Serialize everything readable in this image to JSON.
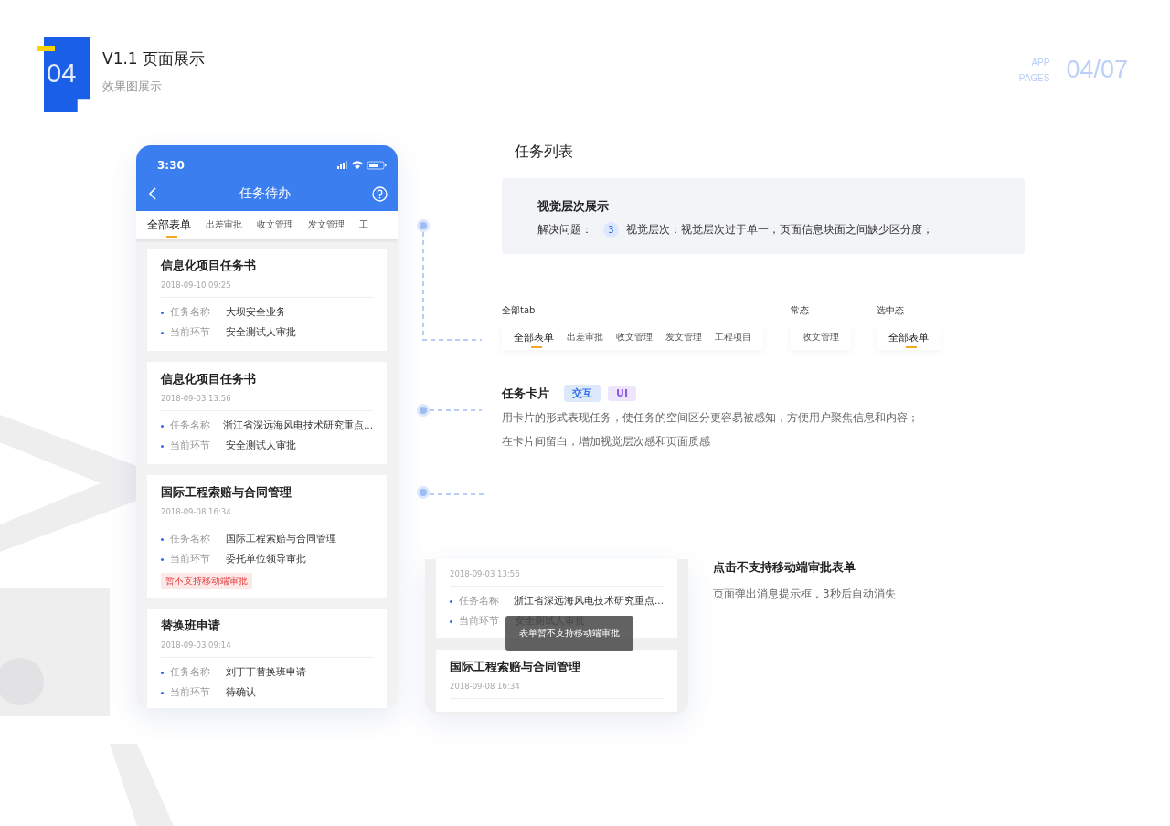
{
  "header": {
    "badge_number": "04",
    "title": "V1.1 页面展示",
    "subtitle": "效果图展示",
    "corner_label_top": "APP",
    "corner_label_bottom": "PAGES",
    "page_counter": "04/07"
  },
  "phone": {
    "time": "3:30",
    "nav_title": "任务待办",
    "tabs": [
      {
        "label": "全部表单",
        "selected": true
      },
      {
        "label": "出差审批",
        "selected": false
      },
      {
        "label": "收文管理",
        "selected": false
      },
      {
        "label": "发文管理",
        "selected": false
      },
      {
        "label": "工",
        "selected": false
      }
    ],
    "cards": [
      {
        "title": "信息化项目任务书",
        "date": "2018-09-10  09:25",
        "fields": [
          {
            "label": "任务名称",
            "value": "大坝安全业务"
          },
          {
            "label": "当前环节",
            "value": "安全测试人审批"
          }
        ]
      },
      {
        "title": "信息化项目任务书",
        "date": "2018-09-03  13:56",
        "fields": [
          {
            "label": "任务名称",
            "value": "浙江省深远海风电技术研究重点..."
          },
          {
            "label": "当前环节",
            "value": "安全测试人审批"
          }
        ]
      },
      {
        "title": "国际工程索赔与合同管理",
        "date": "2018-09-08  16:34",
        "fields": [
          {
            "label": "任务名称",
            "value": "国际工程索赔与合同管理"
          },
          {
            "label": "当前环节",
            "value": "委托单位领导审批"
          }
        ],
        "tag": "暂不支持移动端审批"
      },
      {
        "title": "替换班申请",
        "date": "2018-09-03  09:14",
        "fields": [
          {
            "label": "任务名称",
            "value": "刘丁丁替换班申请"
          },
          {
            "label": "当前环节",
            "value": "待确认"
          }
        ]
      }
    ]
  },
  "section_title": "任务列表",
  "info_box": {
    "heading": "视觉层次展示",
    "label": "解决问题：",
    "number": "3",
    "text": "视觉层次：视觉层次过于单一，页面信息块面之间缺少区分度；"
  },
  "tab_demo": [
    {
      "caption": "全部tab",
      "tabs": [
        {
          "label": "全部表单",
          "selected": true
        },
        {
          "label": "出差审批",
          "selected": false
        },
        {
          "label": "收文管理",
          "selected": false
        },
        {
          "label": "发文管理",
          "selected": false
        },
        {
          "label": "工程项目",
          "selected": false
        }
      ]
    },
    {
      "caption": "常态",
      "tabs": [
        {
          "label": "收文管理",
          "selected": false
        }
      ]
    },
    {
      "caption": "选中态",
      "tabs": [
        {
          "label": "全部表单",
          "selected": true
        }
      ]
    }
  ],
  "card_section": {
    "title": "任务卡片",
    "tags": [
      {
        "label": "交互",
        "color": "#2f6fe8"
      },
      {
        "label": "UI",
        "color": "#8a5ce6"
      }
    ],
    "lines": [
      "用卡片的形式表现任务，使任务的空间区分更容易被感知，方便用户聚焦信息和内容；",
      "在卡片间留白，增加视觉层次感和页面质感"
    ]
  },
  "toast_demo": {
    "cards": [
      {
        "date": "2018-09-03  13:56",
        "fields": [
          {
            "label": "任务名称",
            "value": "浙江省深远海风电技术研究重点..."
          },
          {
            "label": "当前环节",
            "value": "安全测试人审批"
          }
        ]
      },
      {
        "title": "国际工程索赔与合同管理",
        "date": "2018-09-08  16:34"
      }
    ],
    "toast": "表单暂不支持移动端审批",
    "note_title": "点击不支持移动端审批表单",
    "note_text": "页面弹出消息提示框，3秒后自动消失"
  }
}
